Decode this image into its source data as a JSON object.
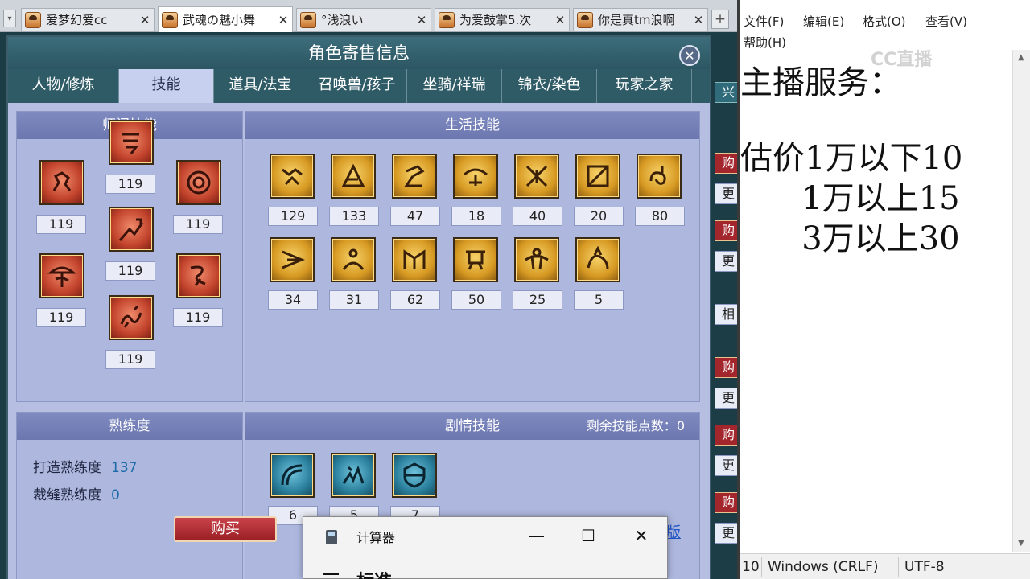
{
  "browser": {
    "tabs": [
      {
        "title": "爱梦幻爱cc",
        "active": false
      },
      {
        "title": "武魂の魅小舞",
        "active": true
      },
      {
        "title": "°浅浪い",
        "active": false
      },
      {
        "title": "为爱鼓掌5.次",
        "active": false
      },
      {
        "title": "你是真tm浪啊",
        "active": false
      }
    ],
    "close_glyph": "✕",
    "add_glyph": "+",
    "dropdown_glyph": "▾"
  },
  "panel": {
    "title": "角色寄售信息",
    "close_glyph": "✕",
    "tabs": [
      "人物/修炼",
      "技能",
      "道具/法宝",
      "召唤兽/孩子",
      "坐骑/祥瑞",
      "锦衣/染色",
      "玩家之家"
    ],
    "active_tab": "技能",
    "sect_skills": {
      "title": "师门技能",
      "levels": [
        "119",
        "119",
        "119",
        "119",
        "119",
        "119",
        "119"
      ]
    },
    "life_skills": {
      "title": "生活技能",
      "levels": [
        "129",
        "133",
        "47",
        "18",
        "40",
        "20",
        "80",
        "34",
        "31",
        "62",
        "50",
        "25",
        "5"
      ]
    },
    "proficiency": {
      "title": "熟练度",
      "rows": [
        {
          "label": "打造熟练度",
          "value": "137"
        },
        {
          "label": "裁缝熟练度",
          "value": "0"
        }
      ]
    },
    "story_skills": {
      "title": "剧情技能",
      "points_label": "剩余技能点数：",
      "points_value": "0",
      "levels": [
        "6",
        "5",
        "7"
      ]
    },
    "buy_label": "购买",
    "edge_link": "版"
  },
  "side_buttons": [
    {
      "label": "兴",
      "style": "teal"
    },
    {
      "label": "购",
      "style": "red"
    },
    {
      "label": "更",
      "style": "white"
    },
    {
      "label": "购",
      "style": "red"
    },
    {
      "label": "更",
      "style": "white"
    },
    {
      "label": "相",
      "style": "white"
    },
    {
      "label": "购",
      "style": "red"
    },
    {
      "label": "更",
      "style": "white"
    },
    {
      "label": "购",
      "style": "red"
    },
    {
      "label": "更",
      "style": "white"
    },
    {
      "label": "购",
      "style": "red"
    },
    {
      "label": "更",
      "style": "white"
    }
  ],
  "calculator": {
    "title": "计算器",
    "minimize": "—",
    "maximize": "☐",
    "close": "✕",
    "mode": "标准"
  },
  "notepad": {
    "menu": [
      "文件(F)",
      "编辑(E)",
      "格式(O)",
      "查看(V)",
      "帮助(H)"
    ],
    "lines": [
      "主播服务：",
      "",
      "估价1万以下10",
      "      1万以上15",
      "      3万以上30"
    ],
    "watermark": "CC直播",
    "status": {
      "position": "10",
      "line_ending": "Windows (CRLF)",
      "encoding": "UTF-8"
    }
  }
}
